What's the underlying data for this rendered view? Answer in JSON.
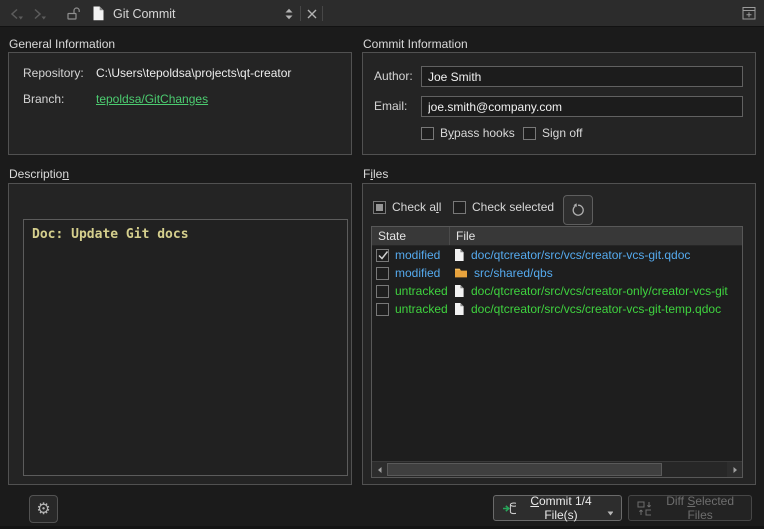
{
  "titlebar": {
    "title": "Git Commit"
  },
  "general": {
    "section_title": "General Information",
    "repository_label": "Repository:",
    "repository_value": "C:\\Users\\tepoldsa\\projects\\qt-creator",
    "branch_label": "Branch:",
    "branch_value": "tepoldsa/GitChanges"
  },
  "commit_info": {
    "section_title": "Commit Information",
    "author_label": "Author:",
    "author_value": "Joe Smith",
    "email_label": "Email:",
    "email_value": "joe.smith@company.com",
    "bypass_hooks_parts": [
      "B",
      "y",
      "pass hooks"
    ],
    "sign_off_label": "Sign off"
  },
  "description": {
    "label_parts": [
      "Descriptio",
      "n",
      ""
    ],
    "text": "Doc: Update Git docs"
  },
  "files": {
    "label_parts": [
      "F",
      "i",
      "les"
    ],
    "check_all_parts": [
      "Check a",
      "l",
      "l"
    ],
    "check_all_state": "partial",
    "check_selected_label": "Check selected",
    "columns": [
      "State",
      "File"
    ],
    "rows": [
      {
        "checked": true,
        "state": "modified",
        "icon": "doc",
        "file": "doc/qtcreator/src/vcs/creator-vcs-git.qdoc"
      },
      {
        "checked": false,
        "state": "modified",
        "icon": "folder",
        "file": "src/shared/qbs"
      },
      {
        "checked": false,
        "state": "untracked",
        "icon": "doc",
        "file": "doc/qtcreator/src/vcs/creator-only/creator-vcs-git"
      },
      {
        "checked": false,
        "state": "untracked",
        "icon": "doc",
        "file": "doc/qtcreator/src/vcs/creator-vcs-git-temp.qdoc"
      }
    ],
    "hscroll_thumb_percent": 81
  },
  "footer": {
    "commit_parts": [
      "",
      "C",
      "ommit 1/4 File(s)"
    ],
    "diff_parts": [
      "Diff ",
      "S",
      "elected Files"
    ]
  },
  "colors": {
    "modified": "#55aaee",
    "untracked": "#3fd33f",
    "branch_link": "#4ccc70",
    "description_text": "#d5cf8d",
    "folder_icon": "#e8a33d",
    "commit_green": "#27a75a"
  }
}
